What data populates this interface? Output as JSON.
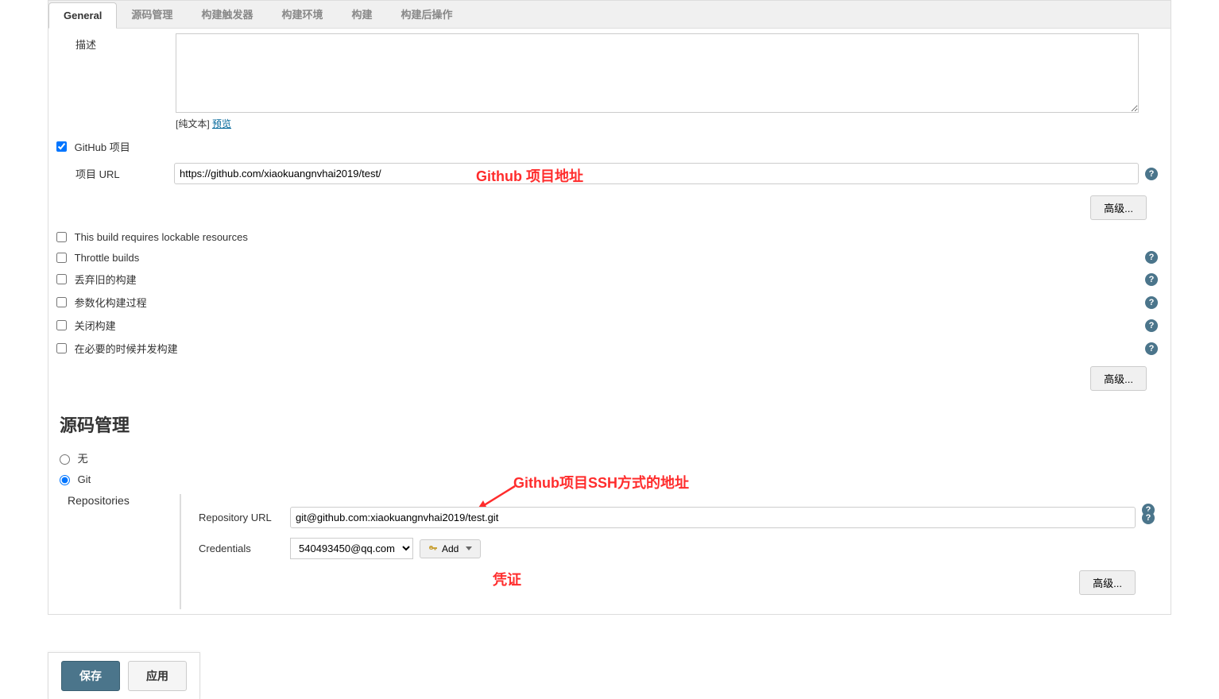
{
  "tabs": {
    "general": "General",
    "scm": "源码管理",
    "triggers": "构建触发器",
    "env": "构建环境",
    "build": "构建",
    "post": "构建后操作"
  },
  "desc": {
    "label": "描述",
    "value": "",
    "rawtext": "[纯文本]",
    "preview": "预览"
  },
  "github": {
    "checkbox": "GitHub 项目",
    "url_label": "项目 URL",
    "url_value": "https://github.com/xiaokuangnvhai2019/test/",
    "annotation": "Github 项目地址",
    "advanced": "高级..."
  },
  "options": {
    "lockable": "This build requires lockable resources",
    "throttle": "Throttle builds",
    "discard": "丢弃旧的构建",
    "param": "参数化构建过程",
    "disable": "关闭构建",
    "concurrent": "在必要的时候并发构建",
    "advanced": "高级..."
  },
  "scm": {
    "title": "源码管理",
    "none": "无",
    "git": "Git",
    "repositories": "Repositories",
    "repo_url_label": "Repository URL",
    "repo_url_value": "git@github.com:xiaokuangnvhai2019/test.git",
    "ssh_annotation": "Github项目SSH方式的地址",
    "cred_label": "Credentials",
    "cred_value": "540493450@qq.com",
    "add_btn": "Add",
    "cred_annotation": "凭证",
    "advanced": "高级..."
  },
  "footer": {
    "save": "保存",
    "apply": "应用"
  }
}
